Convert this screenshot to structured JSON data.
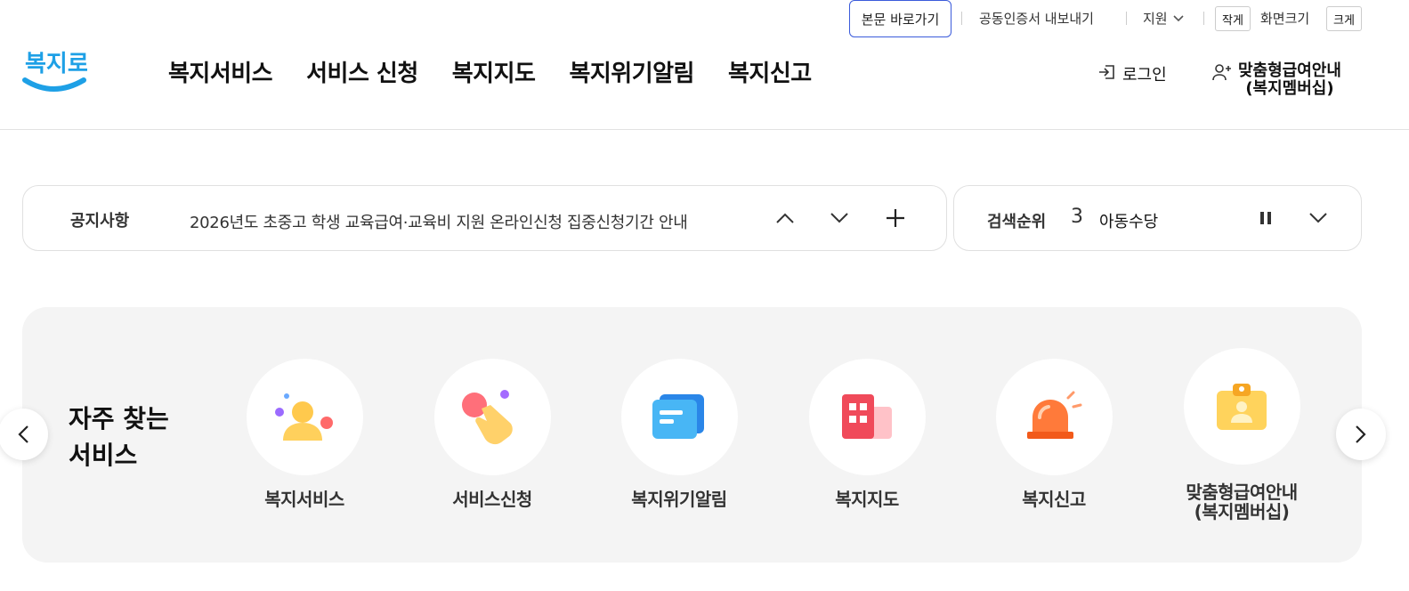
{
  "utility": {
    "skip_link": "본문 바로가기",
    "cert_export": "공동인증서 내보내기",
    "support": "지원",
    "text_small": "작게",
    "screen_size": "화면크기",
    "text_large": "크게"
  },
  "header": {
    "logo_text": "복지로",
    "nav": [
      "복지서비스",
      "서비스 신청",
      "복지지도",
      "복지위기알림",
      "복지신고"
    ],
    "login": "로그인",
    "custom_guide_line1": "맞춤형급여안내",
    "custom_guide_line2": "(복지멤버십)"
  },
  "notice": {
    "label": "공지사항",
    "text": "2026년도 초중고 학생 교육급여·교육비 지원 온라인신청 집중신청기간 안내"
  },
  "search_rank": {
    "label": "검색순위",
    "rank": "3",
    "keyword": "아동수당"
  },
  "services": {
    "title_line1": "자주 찾는",
    "title_line2": "서비스",
    "items": [
      {
        "label": "복지서비스",
        "icon": "person-icon"
      },
      {
        "label": "서비스신청",
        "icon": "hand-tap-icon"
      },
      {
        "label": "복지위기알림",
        "icon": "message-card-icon"
      },
      {
        "label": "복지지도",
        "icon": "building-map-icon"
      },
      {
        "label": "복지신고",
        "icon": "siren-icon"
      },
      {
        "label_line1": "맞춤형급여안내",
        "label_line2": "(복지멤버십)",
        "icon": "membership-card-icon"
      }
    ]
  },
  "colors": {
    "brand_blue": "#1ea0e6",
    "skip_border": "#3b5bdb",
    "panel_bg": "#f4f4f4"
  }
}
